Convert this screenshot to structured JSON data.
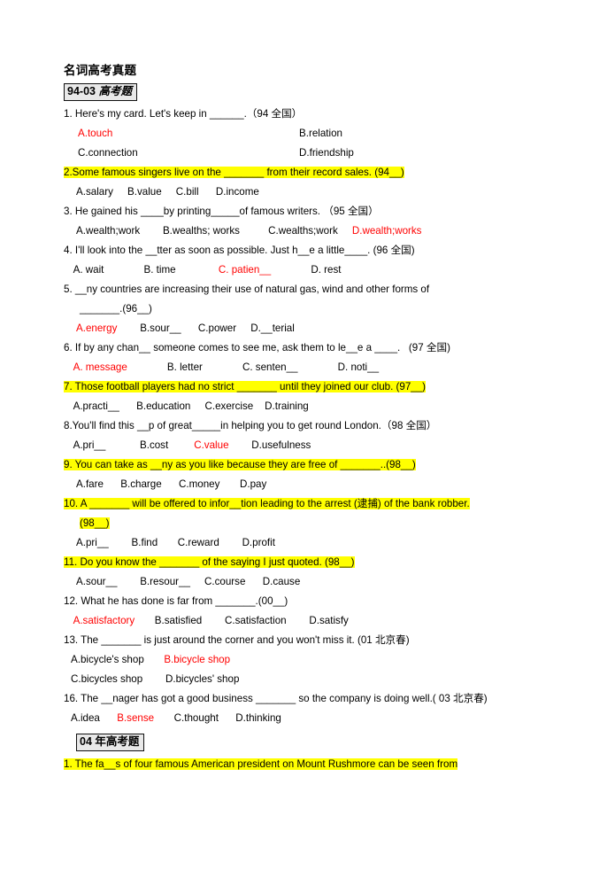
{
  "document": {
    "title": "名词高考真题",
    "section1_label_latin": "94-03 ",
    "section1_label_cn": "高考题",
    "section2_label": "04 年高考题"
  },
  "colors": {
    "answer_red": "#ff0000",
    "highlight_yellow": "#ffff00",
    "text_black": "#000000",
    "head_box_bg": "#e9e9e9"
  },
  "questions": [
    {
      "id": "q1",
      "stem": "1. Here's my card. Let's keep in ______.（94 全国）",
      "highlight": false,
      "layout": "two-column",
      "options": [
        {
          "label": "A.touch",
          "answer": true
        },
        {
          "label": "B.relation",
          "answer": false
        },
        {
          "label": "C.connection",
          "answer": false
        },
        {
          "label": "D.friendship",
          "answer": false
        }
      ]
    },
    {
      "id": "q2",
      "stem": "2.Some famous singers live on the _______ from their record sales. (94__)",
      "highlight": true,
      "layout": "inline",
      "options_line": "A.salary      B.value      C.bill        D.income",
      "options": [
        {
          "label": "A.salary",
          "answer": false
        },
        {
          "label": "B.value",
          "answer": false
        },
        {
          "label": "C.bill",
          "answer": false
        },
        {
          "label": "D.income",
          "answer": false
        }
      ]
    },
    {
      "id": "q3",
      "stem": "3. He gained his ____by printing_____of famous writers. （95 全国）",
      "highlight": false,
      "layout": "inline-mixed",
      "options": [
        {
          "label": "A.wealth;work",
          "answer": false
        },
        {
          "label": "B.wealths; works",
          "answer": false
        },
        {
          "label": "C.wealths;work",
          "answer": false
        },
        {
          "label": "D.wealth;works",
          "answer": true
        }
      ]
    },
    {
      "id": "q4",
      "stem": "4. I'll look into the __tter as soon as possible. Just h__e a little____. (96 全国)",
      "highlight": false,
      "layout": "inline-mixed",
      "options": [
        {
          "label": "A. wait",
          "answer": false
        },
        {
          "label": "B. time",
          "answer": false
        },
        {
          "label": "C. patien__",
          "answer": true
        },
        {
          "label": "D. rest",
          "answer": false
        }
      ]
    },
    {
      "id": "q5",
      "stem": "5. __ny countries are increasing their use of natural gas, wind and other forms of",
      "stem_cont": "_______.(96__)",
      "highlight": false,
      "layout": "inline-mixed",
      "options": [
        {
          "label": "A.energy",
          "answer": true
        },
        {
          "label": "B.sour__",
          "answer": false
        },
        {
          "label": "C.power",
          "answer": false
        },
        {
          "label": "D.__terial",
          "answer": false
        }
      ]
    },
    {
      "id": "q6",
      "stem": "6. If by any chan__ someone comes to see me, ask them to le__e a ____.   (97 全国)",
      "highlight": false,
      "layout": "inline-mixed",
      "options": [
        {
          "label": "A. message",
          "answer": true
        },
        {
          "label": "B. letter",
          "answer": false
        },
        {
          "label": "C. senten__",
          "answer": false
        },
        {
          "label": "D. noti__",
          "answer": false
        }
      ]
    },
    {
      "id": "q7",
      "stem": "7. Those football players had no strict _______ until they joined our club. (97__)",
      "highlight": true,
      "layout": "inline",
      "options": [
        {
          "label": "A.practi__",
          "answer": false
        },
        {
          "label": "B.education",
          "answer": false
        },
        {
          "label": "C.exercise",
          "answer": false
        },
        {
          "label": "D.training",
          "answer": false
        }
      ]
    },
    {
      "id": "q8",
      "stem": "8.You'll find this __p of great_____in helping you to get round London.（98 全国）",
      "highlight": false,
      "layout": "inline-mixed",
      "options": [
        {
          "label": "A.pri__",
          "answer": false
        },
        {
          "label": "B.cost",
          "answer": false
        },
        {
          "label": "C.value",
          "answer": true
        },
        {
          "label": "D.usefulness",
          "answer": false
        }
      ]
    },
    {
      "id": "q9",
      "stem": "9. You can take as __ny as you like because they are free of _______..(98__)",
      "highlight": true,
      "layout": "inline",
      "options": [
        {
          "label": "A.fare",
          "answer": false
        },
        {
          "label": "B.charge",
          "answer": false
        },
        {
          "label": "C.money",
          "answer": false
        },
        {
          "label": "D.pay",
          "answer": false
        }
      ]
    },
    {
      "id": "q10",
      "stem": "10. A _______ will be offered to infor__tion leading to the arrest (逮捕) of the bank robber.",
      "stem_cont": "(98__)",
      "highlight": true,
      "layout": "inline",
      "options": [
        {
          "label": "A.pri__",
          "answer": false
        },
        {
          "label": "B.find",
          "answer": false
        },
        {
          "label": "C.reward",
          "answer": false
        },
        {
          "label": "D.profit",
          "answer": false
        }
      ]
    },
    {
      "id": "q11",
      "stem": "11. Do you know the _______ of the saying I just quoted. (98__)",
      "highlight": true,
      "layout": "inline",
      "options": [
        {
          "label": "A.sour__",
          "answer": false
        },
        {
          "label": "B.resour__",
          "answer": false
        },
        {
          "label": "C.course",
          "answer": false
        },
        {
          "label": "D.cause",
          "answer": false
        }
      ]
    },
    {
      "id": "q12",
      "stem": "12. What he has done is far from _______.(00__)",
      "highlight": false,
      "layout": "inline-mixed",
      "options": [
        {
          "label": "A.satisfactory",
          "answer": true
        },
        {
          "label": "B.satisfied",
          "answer": false
        },
        {
          "label": "C.satisfaction",
          "answer": false
        },
        {
          "label": "D.satisfy",
          "answer": false
        }
      ]
    },
    {
      "id": "q13",
      "stem": "13. The _______ is just around the corner and you won't miss it. (01 北京春)",
      "highlight": false,
      "layout": "two-column",
      "options": [
        {
          "label": "A.bicycle's shop",
          "answer": false
        },
        {
          "label": "B.bicycle shop",
          "answer": true
        },
        {
          "label": "C.bicycles shop",
          "answer": false
        },
        {
          "label": "D.bicycles' shop",
          "answer": false
        }
      ]
    },
    {
      "id": "q16",
      "stem": "16. The __nager has got a good business _______ so the company is doing well.( 03 北京春)",
      "highlight": false,
      "layout": "inline-mixed",
      "options": [
        {
          "label": "A.idea",
          "answer": false
        },
        {
          "label": "B.sense",
          "answer": true
        },
        {
          "label": "C.thought",
          "answer": false
        },
        {
          "label": "D.thinking",
          "answer": false
        }
      ]
    },
    {
      "id": "s2q1",
      "stem": "1. The fa__s of four famous American president on Mount Rushmore can be seen from",
      "highlight": true,
      "layout": "inline",
      "options": []
    }
  ]
}
